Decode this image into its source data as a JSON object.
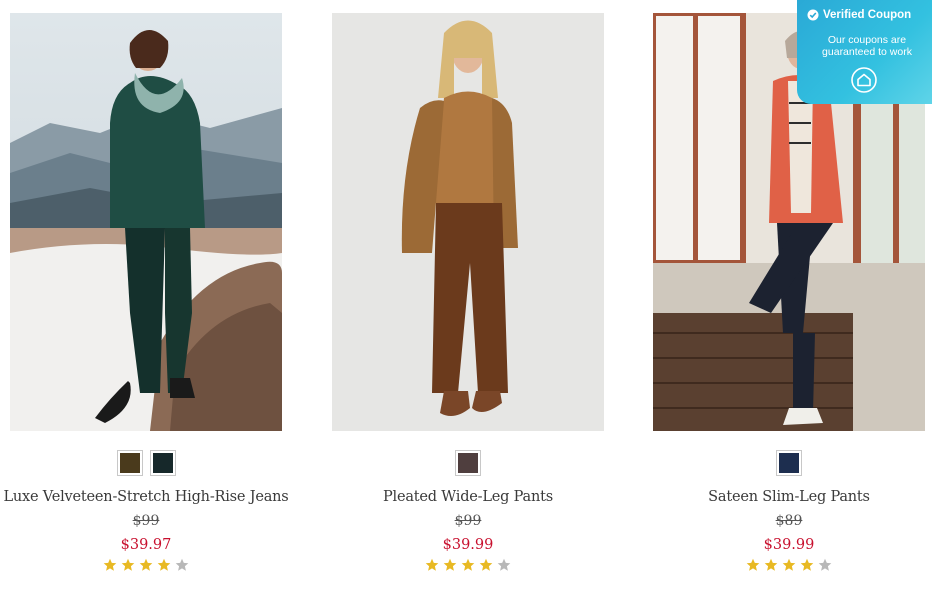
{
  "products": [
    {
      "name": "Luxe Velveteen-Stretch High-Rise Jeans",
      "original_price": "$99",
      "sale_price": "$39.97",
      "rating": 4,
      "rating_max": 5,
      "swatches": [
        "#4a3a1c",
        "#16282a"
      ]
    },
    {
      "name": "Pleated Wide-Leg Pants",
      "original_price": "$99",
      "sale_price": "$39.99",
      "rating": 4,
      "rating_max": 5,
      "swatches": [
        "#4f3e3e"
      ]
    },
    {
      "name": "Sateen Slim-Leg Pants",
      "original_price": "$89",
      "sale_price": "$39.99",
      "rating": 4,
      "rating_max": 5,
      "swatches": [
        "#1d2e4f"
      ]
    }
  ],
  "coupon": {
    "title": "Verified Coupon",
    "subtitle": "Our coupons are guaranteed to work",
    "icon": "house-logo-icon"
  },
  "colors": {
    "sale": "#c8102e",
    "star_filled": "#e8b923",
    "star_empty": "#b8b8b8",
    "coupon_bg": "#2fb4dc"
  }
}
